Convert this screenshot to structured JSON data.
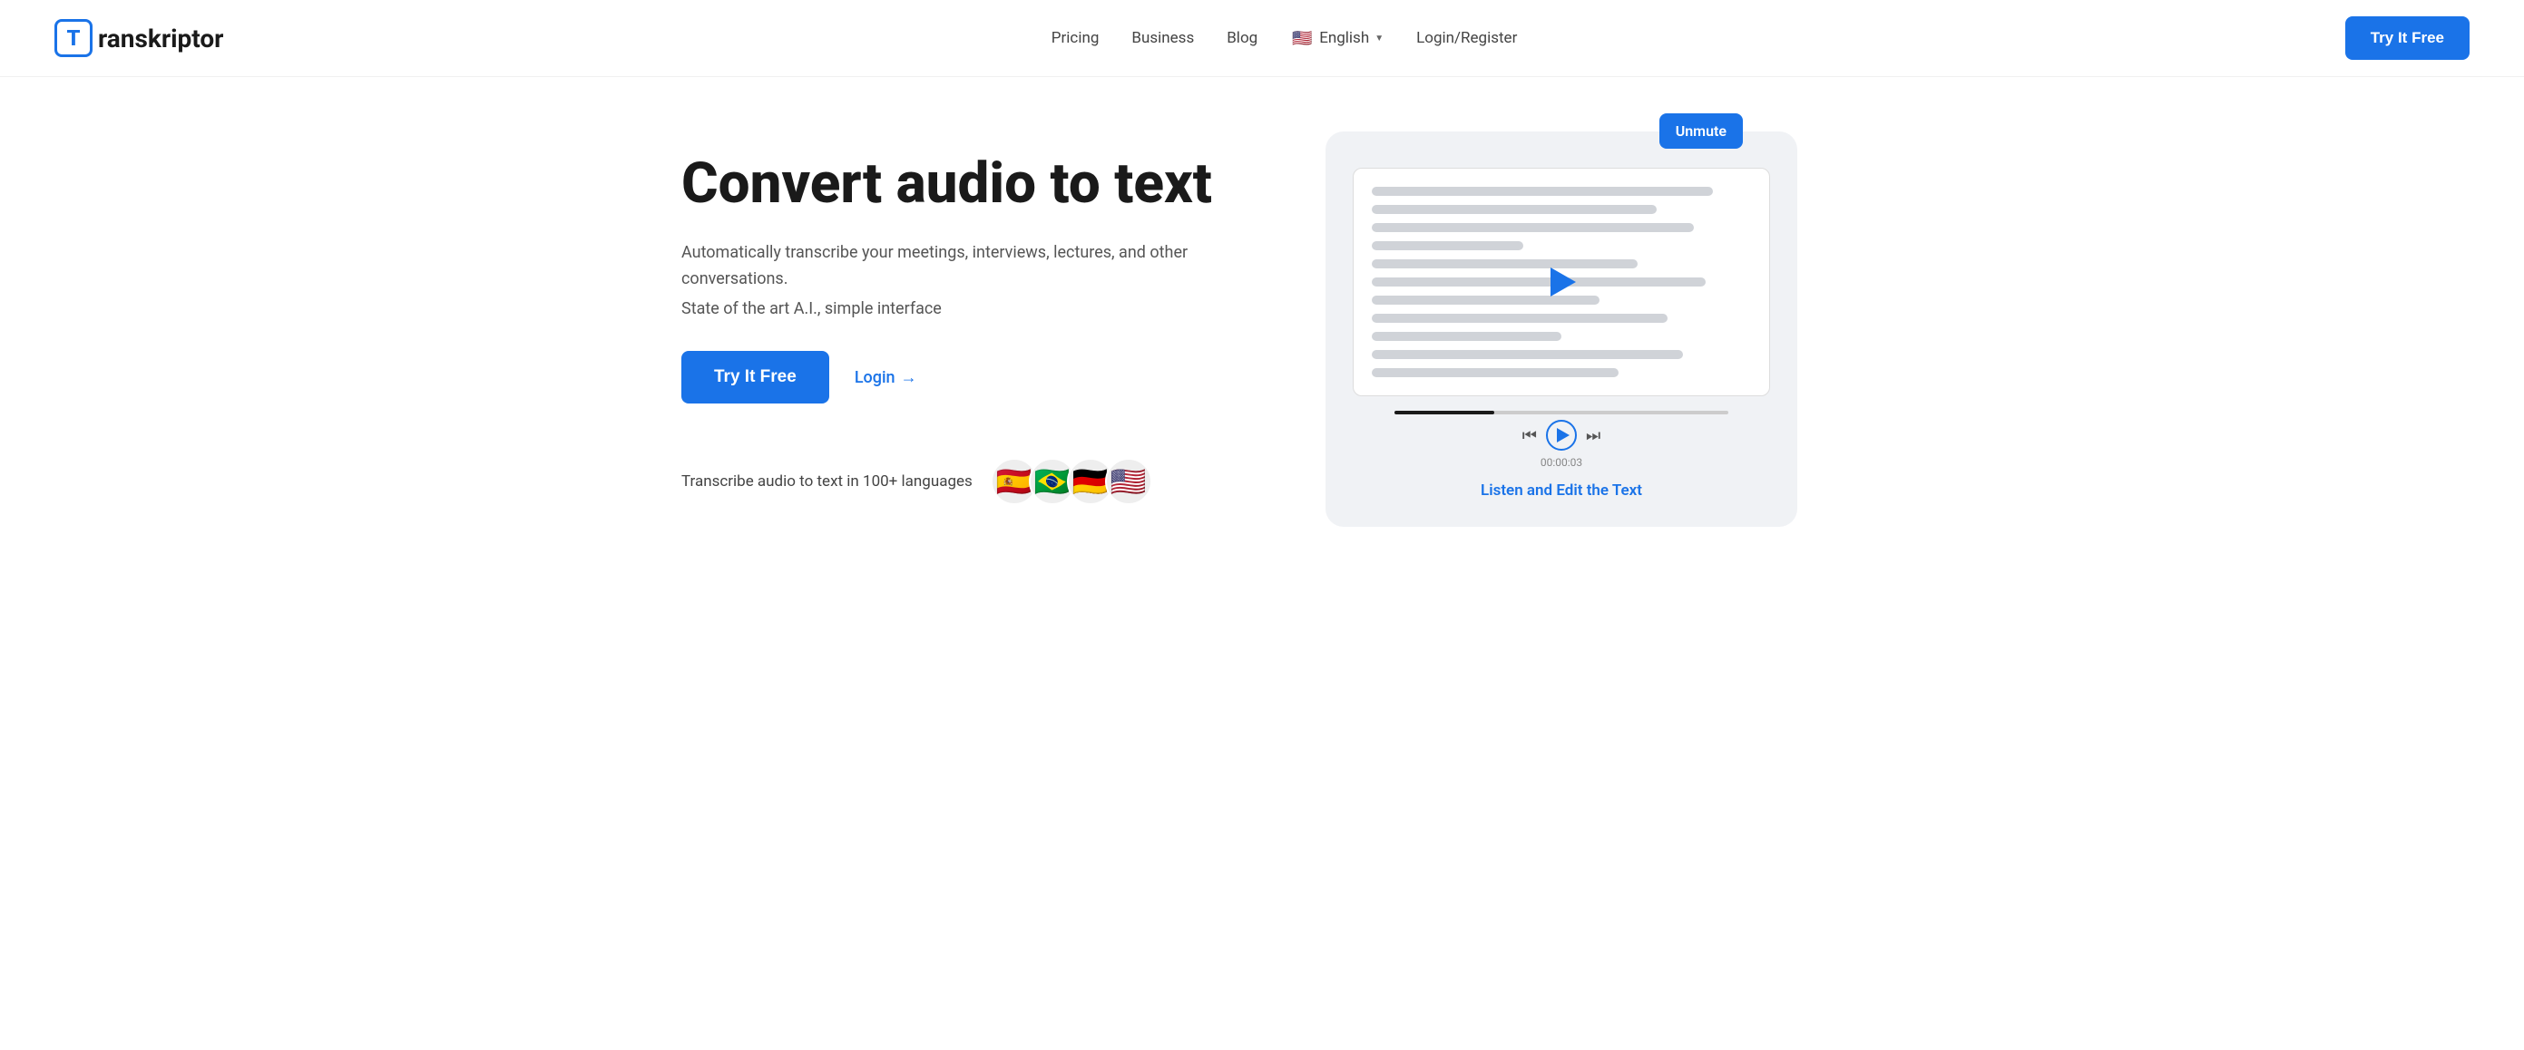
{
  "logo": {
    "letter": "T",
    "name": "ranskriptor"
  },
  "nav": {
    "links": [
      {
        "id": "pricing",
        "label": "Pricing",
        "href": "#"
      },
      {
        "id": "business",
        "label": "Business",
        "href": "#"
      },
      {
        "id": "blog",
        "label": "Blog",
        "href": "#"
      }
    ],
    "language": {
      "flag": "🇺🇸",
      "label": "English"
    },
    "login_label": "Login/Register",
    "try_label": "Try It Free"
  },
  "hero": {
    "title": "Convert audio to text",
    "description1": "Automatically transcribe your meetings, interviews, lectures, and other conversations.",
    "description2": "State of the art A.I., simple interface",
    "try_label": "Try It Free",
    "login_label": "Login",
    "login_arrow": "→",
    "languages_text": "Transcribe audio to text in 100+ languages",
    "flags": [
      "🇪🇸",
      "🇧🇷",
      "🇩🇪",
      "🇺🇸"
    ]
  },
  "visual": {
    "unmute_label": "Unmute",
    "timestamp": "00:00:03",
    "edit_caption": "Listen and Edit the Text"
  },
  "colors": {
    "primary": "#1a73e8",
    "text_dark": "#1a1a1a",
    "text_mid": "#555",
    "bg_light": "#f0f2f5"
  }
}
